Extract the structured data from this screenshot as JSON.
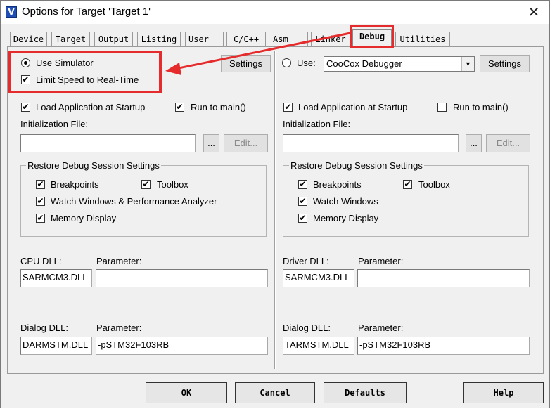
{
  "window": {
    "title": "Options for Target 'Target 1'",
    "app_icon_glyph": "V",
    "close_glyph": "✕"
  },
  "tabs": [
    {
      "label": "Device"
    },
    {
      "label": "Target"
    },
    {
      "label": "Output"
    },
    {
      "label": "Listing"
    },
    {
      "label": "User"
    },
    {
      "label": "C/C++"
    },
    {
      "label": "Asm"
    },
    {
      "label": "Linker"
    },
    {
      "label": "Debug",
      "active": true
    },
    {
      "label": "Utilities"
    }
  ],
  "left": {
    "use_simulator": {
      "label": "Use Simulator",
      "checked": true
    },
    "limit_speed": {
      "label": "Limit Speed to Real-Time",
      "checked": true
    },
    "settings_label": "Settings",
    "load_app": {
      "label": "Load Application at Startup",
      "checked": true
    },
    "run_to_main": {
      "label": "Run to main()",
      "checked": true
    },
    "init_file_label": "Initialization File:",
    "init_file_value": "",
    "browse_label": "...",
    "edit_label": "Edit...",
    "restore_group": "Restore Debug Session Settings",
    "breakpoints": {
      "label": "Breakpoints",
      "checked": true
    },
    "toolbox": {
      "label": "Toolbox",
      "checked": true
    },
    "watch_windows": {
      "label": "Watch Windows & Performance Analyzer",
      "checked": true
    },
    "memory_display": {
      "label": "Memory Display",
      "checked": true
    },
    "cpu_dll_label": "CPU DLL:",
    "cpu_dll_value": "SARMCM3.DLL",
    "cpu_param_label": "Parameter:",
    "cpu_param_value": "",
    "dialog_dll_label": "Dialog DLL:",
    "dialog_dll_value": "DARMSTM.DLL",
    "dialog_param_label": "Parameter:",
    "dialog_param_value": "-pSTM32F103RB"
  },
  "right": {
    "use": {
      "label": "Use:",
      "checked": false
    },
    "debugger_selected": "CooCox Debugger",
    "settings_label": "Settings",
    "load_app": {
      "label": "Load Application at Startup",
      "checked": true
    },
    "run_to_main": {
      "label": "Run to main()",
      "checked": false
    },
    "init_file_label": "Initialization File:",
    "init_file_value": "",
    "browse_label": "...",
    "edit_label": "Edit...",
    "restore_group": "Restore Debug Session Settings",
    "breakpoints": {
      "label": "Breakpoints",
      "checked": true
    },
    "toolbox": {
      "label": "Toolbox",
      "checked": true
    },
    "watch_windows": {
      "label": "Watch Windows",
      "checked": true
    },
    "memory_display": {
      "label": "Memory Display",
      "checked": true
    },
    "driver_dll_label": "Driver DLL:",
    "driver_dll_value": "SARMCM3.DLL",
    "driver_param_label": "Parameter:",
    "driver_param_value": "",
    "dialog_dll_label": "Dialog DLL:",
    "dialog_dll_value": "TARMSTM.DLL",
    "dialog_param_label": "Parameter:",
    "dialog_param_value": "-pSTM32F103RB"
  },
  "footer": {
    "ok_label": "OK",
    "cancel_label": "Cancel",
    "defaults_label": "Defaults",
    "help_label": "Help"
  },
  "annotation": {
    "highlight_color": "#e52b2b"
  },
  "check_glyph": "✔"
}
